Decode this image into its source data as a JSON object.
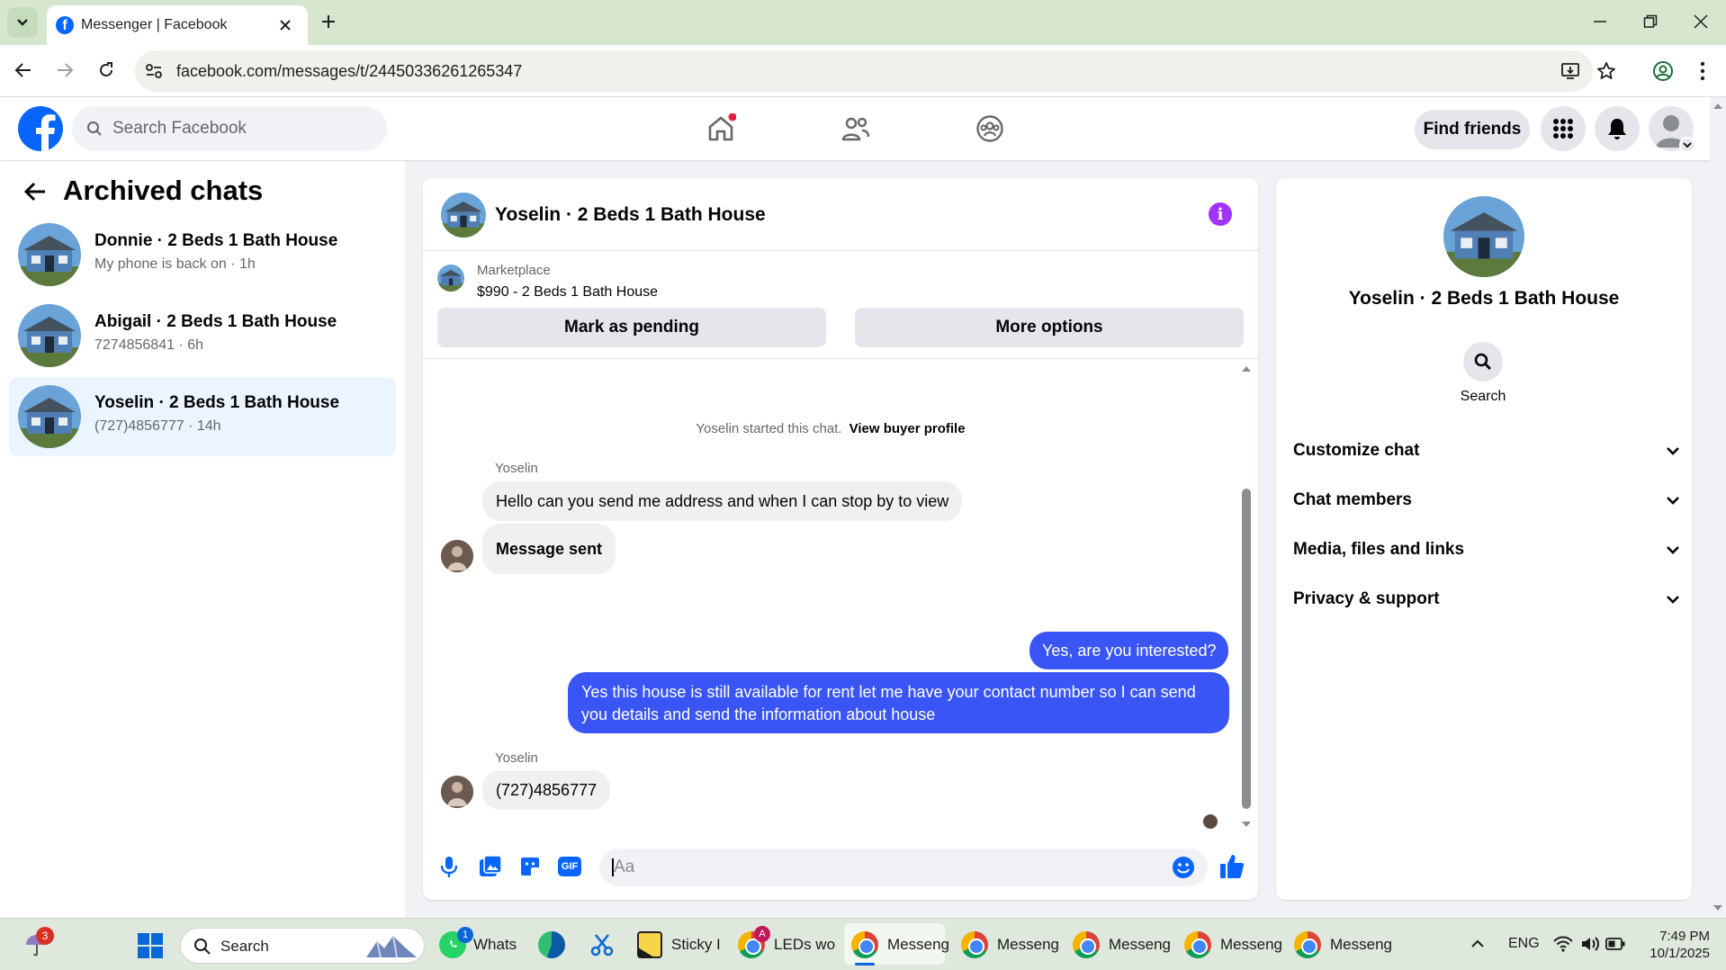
{
  "browser": {
    "tab_title": "Messenger | Facebook",
    "url": "facebook.com/messages/t/24450336261265347"
  },
  "header": {
    "search_placeholder": "Search Facebook",
    "find_friends": "Find friends"
  },
  "sidebar": {
    "title": "Archived chats",
    "chats": [
      {
        "name": "Donnie · 2 Beds 1 Bath House",
        "preview": "My phone is back on · 1h"
      },
      {
        "name": "Abigail · 2 Beds 1 Bath House",
        "preview": "7274856841 · 6h"
      },
      {
        "name": "Yoselin · 2 Beds 1 Bath House",
        "preview": "(727)4856777 · 14h"
      }
    ]
  },
  "conversation": {
    "title": "Yoselin · 2 Beds 1 Bath House",
    "marketplace_label": "Marketplace",
    "listing": "$990 - 2 Beds 1 Bath House",
    "mark_pending": "Mark as pending",
    "more_options": "More options",
    "started_text": "Yoselin started this chat.",
    "view_buyer": "View buyer profile",
    "sender1": "Yoselin",
    "msg1": "Hello can you send me address and when I can stop by to view",
    "msg2": "Message sent",
    "msg3": "Yes, are you interested?",
    "msg4": "Yes this house is still available for rent let me have your contact number so I can send you details and send the information about house",
    "sender2": "Yoselin",
    "msg5": "(727)4856777",
    "composer_placeholder": "Aa"
  },
  "details": {
    "name": "Yoselin · 2 Beds 1 Bath House",
    "search_label": "Search",
    "sections": [
      "Customize chat",
      "Chat members",
      "Media, files and links",
      "Privacy & support"
    ]
  },
  "taskbar": {
    "badge_weather": "3",
    "search": "Search",
    "whatsapp": "Whats",
    "whatsapp_badge": "1",
    "sticky": "Sticky I",
    "leds": "LEDs wo",
    "leds_badge": "A",
    "messenger_windows": [
      "Messeng",
      "Messeng",
      "Messeng",
      "Messeng",
      "Messeng"
    ],
    "lang": "ENG",
    "time": "7:49 PM",
    "date": "10/1/2025"
  },
  "colors": {
    "fb_blue": "#0866ff",
    "outgoing_bubble": "#3a55f5",
    "accent_purple": "#a033ff",
    "active_row": "#ebf5ff"
  }
}
